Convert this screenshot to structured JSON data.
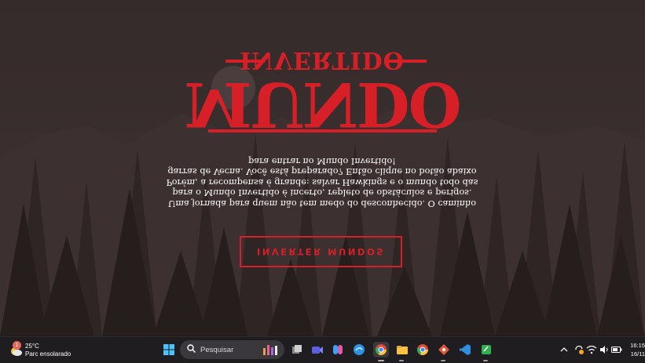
{
  "hero": {
    "title_small": "INVERTIDO",
    "title_big": "MUNDO",
    "description": "Uma jornada para quem não tem medo do desconhecido. O caminho para o Mundo Invertido é incerto, repleto de obstáculos e perigos. Porém, a recompensa é grande: salvar Hawkings e o mundo todo das garras de Vecna. Você está preparado? Então clique no botão abaixo para entrar no Mundo Invertido!",
    "cta_label": "INVERTER MUNDOS",
    "accent_color": "#d61f26"
  },
  "taskbar": {
    "weather": {
      "temperature": "25°C",
      "condition": "Parc ensolarado",
      "badge": "1"
    },
    "search_placeholder": "Pesquisar",
    "apps": [
      "windows-start-icon",
      "task-view-icon",
      "meet-icon",
      "copilot-icon",
      "edge-icon",
      "chrome-icon",
      "file-explorer-icon",
      "chrome-profile-icon",
      "git-icon",
      "vscode-icon",
      "notes-icon"
    ],
    "clock": {
      "time": "16:15",
      "date": "16/11"
    }
  }
}
